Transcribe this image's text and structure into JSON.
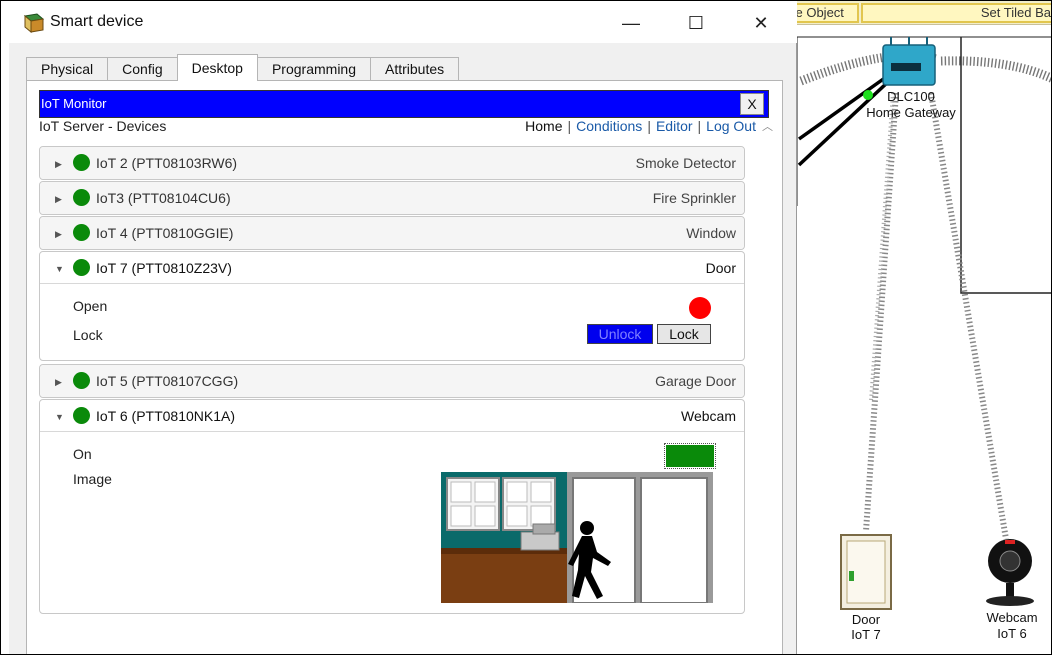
{
  "window": {
    "title": "Smart device",
    "minimize_glyph": "—",
    "maximize_glyph": "☐",
    "close_glyph": "✕"
  },
  "tabs": [
    {
      "label": "Physical",
      "active": false
    },
    {
      "label": "Config",
      "active": false
    },
    {
      "label": "Desktop",
      "active": true
    },
    {
      "label": "Programming",
      "active": false
    },
    {
      "label": "Attributes",
      "active": false
    }
  ],
  "iot_monitor": {
    "title": "IoT Monitor",
    "close_label": "X",
    "header_color": "#0000ff",
    "server_label": "IoT Server - Devices",
    "nav": {
      "home": "Home",
      "conditions": "Conditions",
      "editor": "Editor",
      "logout": "Log Out",
      "separator": "|"
    }
  },
  "devices": [
    {
      "name": "IoT 2 (PTT08103RW6)",
      "type": "Smoke Detector",
      "status_color": "#0a8a0a",
      "expanded": false
    },
    {
      "name": "IoT3 (PTT08104CU6)",
      "type": "Fire Sprinkler",
      "status_color": "#0a8a0a",
      "expanded": false
    },
    {
      "name": "IoT 4 (PTT0810GGIE)",
      "type": "Window",
      "status_color": "#0a8a0a",
      "expanded": false
    },
    {
      "name": "IoT 7 (PTT0810Z23V)",
      "type": "Door",
      "status_color": "#0a8a0a",
      "expanded": true,
      "properties": {
        "open_label": "Open",
        "open_state_color": "#ff0000",
        "lock_label": "Lock",
        "unlock_button": "Unlock",
        "lock_button": "Lock",
        "unlock_selected": true
      }
    },
    {
      "name": "IoT 5 (PTT08107CGG)",
      "type": "Garage Door",
      "status_color": "#0a8a0a",
      "expanded": false
    },
    {
      "name": "IoT 6 (PTT0810NK1A)",
      "type": "Webcam",
      "status_color": "#0a8a0a",
      "expanded": true,
      "properties": {
        "on_label": "On",
        "on_state": true,
        "on_color": "#0a8a0a",
        "image_label": "Image"
      }
    }
  ],
  "workspace": {
    "toolbar_buttons": [
      "ve Object",
      "Set Tiled Ba"
    ],
    "gateway_label_line1": "DLC100",
    "gateway_label_line2": "Home Gateway",
    "door_label_line1": "Door",
    "door_label_line2": "IoT 7",
    "webcam_label_line1": "Webcam",
    "webcam_label_line2": "IoT 6",
    "gateway_color": "#2fa7c9"
  },
  "icons": [
    "app-icon",
    "minimize-icon",
    "maximize-icon",
    "close-icon",
    "caret-right-icon",
    "caret-down-icon",
    "scroll-up-icon",
    "gateway-icon",
    "door-icon",
    "webcam-icon"
  ]
}
